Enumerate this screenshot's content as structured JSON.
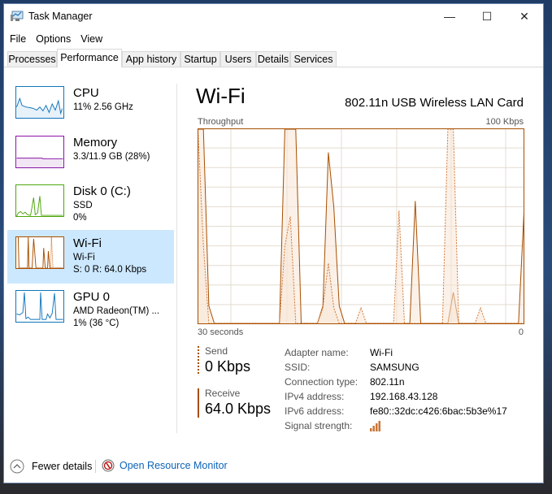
{
  "window": {
    "title": "Task Manager",
    "controls": {
      "minimize": "—",
      "maximize": "☐",
      "close": "✕"
    }
  },
  "menu": [
    "File",
    "Options",
    "View"
  ],
  "tabs": [
    {
      "label": "Processes",
      "active": false
    },
    {
      "label": "Performance",
      "active": true
    },
    {
      "label": "App history",
      "active": false
    },
    {
      "label": "Startup",
      "active": false
    },
    {
      "label": "Users",
      "active": false
    },
    {
      "label": "Details",
      "active": false
    },
    {
      "label": "Services",
      "active": false
    }
  ],
  "sidebar": {
    "items": [
      {
        "name": "CPU",
        "line1": "11%  2.56 GHz",
        "line2": "",
        "color": "#1175ba",
        "selected": false
      },
      {
        "name": "Memory",
        "line1": "3.3/11.9 GB (28%)",
        "line2": "",
        "color": "#8b14a8",
        "selected": false
      },
      {
        "name": "Disk 0 (C:)",
        "line1": "SSD",
        "line2": "0%",
        "color": "#4da60c",
        "selected": false
      },
      {
        "name": "Wi-Fi",
        "line1": "Wi-Fi",
        "line2": "S: 0 R: 64.0 Kbps",
        "color": "#a74f01",
        "selected": true
      },
      {
        "name": "GPU 0",
        "line1": "AMD Radeon(TM) ...",
        "line2": "1%  (36 °C)",
        "color": "#1175ba",
        "selected": false
      }
    ]
  },
  "main": {
    "title": "Wi-Fi",
    "adapter_model": "802.11n USB Wireless LAN Card",
    "throughput_label": "Throughput",
    "max_label": "100 Kbps",
    "time_label": "30 seconds",
    "min_label": "0",
    "send": {
      "label": "Send",
      "value": "0 Kbps"
    },
    "receive": {
      "label": "Receive",
      "value": "64.0 Kbps"
    },
    "properties": [
      {
        "key": "Adapter name:",
        "value": "Wi-Fi"
      },
      {
        "key": "SSID:",
        "value": "SAMSUNG"
      },
      {
        "key": "Connection type:",
        "value": "802.11n"
      },
      {
        "key": "IPv4 address:",
        "value": "192.168.43.128"
      },
      {
        "key": "IPv6 address:",
        "value": "fe80::32dc:c426:6bac:5b3e%17"
      },
      {
        "key": "Signal strength:",
        "value": "signal-bars-4-of-4"
      }
    ],
    "accent_color": "#a74f01"
  },
  "footer": {
    "fewer_details": "Fewer details",
    "resource_monitor": "Open Resource Monitor"
  },
  "chart_data": {
    "type": "area",
    "title": "Throughput",
    "xlabel": "30 seconds",
    "ylabel": "Kbps",
    "ylim": [
      0,
      100
    ],
    "xlim": [
      -30,
      0
    ],
    "grid": true,
    "series": [
      {
        "name": "Receive",
        "style": "solid",
        "values": [
          100,
          100,
          9,
          0,
          0,
          0,
          0,
          0,
          0,
          0,
          0,
          0,
          0,
          0,
          0,
          0,
          100,
          100,
          100,
          0,
          0,
          0,
          0,
          9,
          88,
          60,
          9,
          0,
          0,
          0,
          0,
          0,
          0,
          0,
          0,
          0,
          0,
          0,
          0,
          0,
          63,
          0,
          0,
          0,
          0,
          0,
          0,
          16,
          0,
          0,
          0,
          0,
          0,
          0,
          0,
          0,
          0,
          0,
          0,
          0,
          57
        ]
      },
      {
        "name": "Send",
        "style": "dashed",
        "values": [
          100,
          40,
          0,
          0,
          0,
          0,
          0,
          0,
          0,
          0,
          0,
          0,
          0,
          0,
          0,
          0,
          40,
          55,
          0,
          0,
          0,
          0,
          0,
          8,
          31,
          8,
          0,
          0,
          0,
          0,
          8,
          0,
          0,
          0,
          0,
          0,
          0,
          58,
          0,
          0,
          0,
          0,
          0,
          0,
          0,
          0,
          100,
          100,
          0,
          0,
          0,
          0,
          8,
          0,
          0,
          0,
          0,
          0,
          0,
          0,
          0
        ]
      }
    ]
  }
}
